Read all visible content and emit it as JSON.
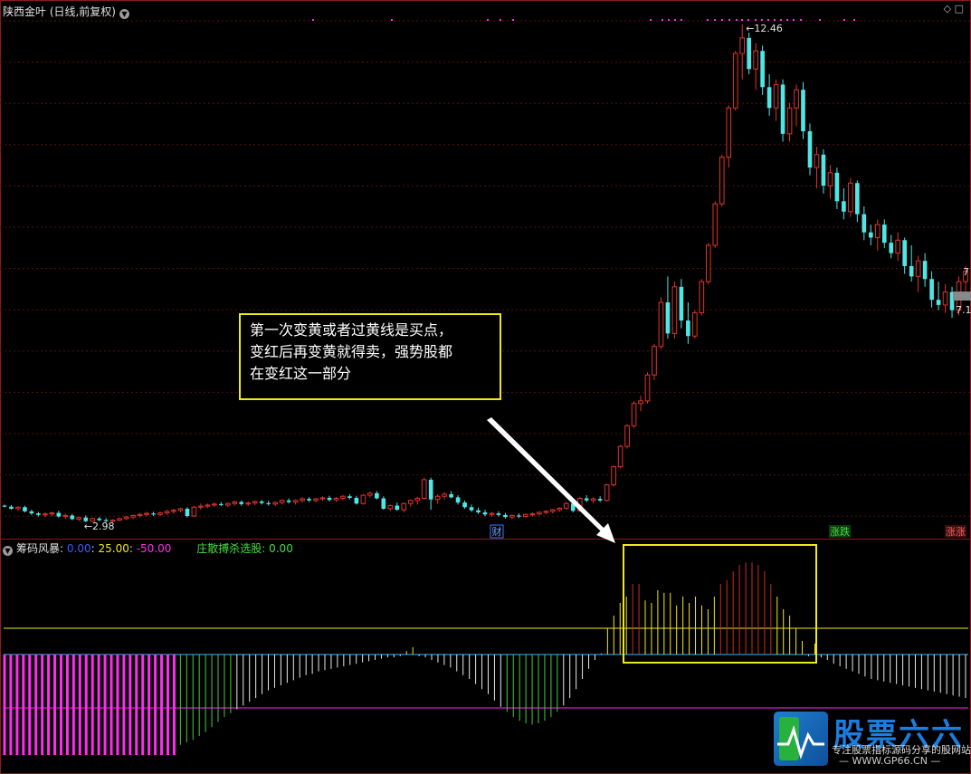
{
  "header": {
    "title": "陕西金叶 (日线,前复权)",
    "dropdown_icon": "chevron-down-icon",
    "right_icons": "◇ □"
  },
  "indicator_header": {
    "name": "筹码风暴",
    "v1": "0.00",
    "v2": "25.00",
    "v3": "-50.00",
    "sep": ":",
    "label2": "庄散搏杀选股:",
    "v4": "0.00"
  },
  "colors": {
    "up": "#e0342a",
    "down": "#50e6e6",
    "yellow": "#f0e81c",
    "magenta": "#ff2cf0",
    "green": "#44cc44",
    "grid": "#5a0e0e"
  },
  "markers": {
    "cai": "财",
    "fluctuate": "涨跌",
    "limit_up": "涨涨"
  },
  "price_labels": {
    "high": "12.46",
    "low": "2.98",
    "right_top": "7",
    "right_bottom": "7.1"
  },
  "annotation": {
    "line1": "第一次变黄或者过黄线是买点，",
    "line2": "变红后再变黄就得卖，强势股都",
    "line3": "在变红这一部分"
  },
  "logo": {
    "name": "股票六六",
    "slogan": "专注股票指标源码分享的股网站",
    "url": "— WWW.GP66.CN —"
  },
  "chart_data": {
    "type": "candlestick",
    "title": "陕西金叶 (日线,前复权)",
    "annotations": [
      "12.46",
      "2.98"
    ],
    "candles_ohlc": [
      [
        3.18,
        3.2,
        3.15,
        3.16
      ],
      [
        3.16,
        3.19,
        3.1,
        3.12
      ],
      [
        3.12,
        3.17,
        3.08,
        3.15
      ],
      [
        3.15,
        3.18,
        3.05,
        3.07
      ],
      [
        3.07,
        3.1,
        3.0,
        3.03
      ],
      [
        3.03,
        3.06,
        2.97,
        3.0
      ],
      [
        3.0,
        3.05,
        2.96,
        3.02
      ],
      [
        3.02,
        3.06,
        2.98,
        3.04
      ],
      [
        3.04,
        3.08,
        2.95,
        2.97
      ],
      [
        2.97,
        3.02,
        2.92,
        2.99
      ],
      [
        2.99,
        3.02,
        2.9,
        2.92
      ],
      [
        2.92,
        2.97,
        2.88,
        2.95
      ],
      [
        2.95,
        2.99,
        2.86,
        2.88
      ],
      [
        2.88,
        2.95,
        2.86,
        2.93
      ],
      [
        2.93,
        2.96,
        2.88,
        2.9
      ],
      [
        2.9,
        2.94,
        2.86,
        2.88
      ],
      [
        2.88,
        2.92,
        2.86,
        2.9
      ],
      [
        2.9,
        2.95,
        2.88,
        2.93
      ],
      [
        2.93,
        2.98,
        2.9,
        2.96
      ],
      [
        2.96,
        3.01,
        2.92,
        2.99
      ],
      [
        2.99,
        3.04,
        2.95,
        3.01
      ],
      [
        3.01,
        3.06,
        2.97,
        3.03
      ],
      [
        3.03,
        3.06,
        2.98,
        3.01
      ],
      [
        3.01,
        3.06,
        2.98,
        3.04
      ],
      [
        3.04,
        3.1,
        3.0,
        3.07
      ],
      [
        3.07,
        3.12,
        3.02,
        3.09
      ],
      [
        3.09,
        3.14,
        3.05,
        3.12
      ],
      [
        3.12,
        3.15,
        2.95,
        2.98
      ],
      [
        2.98,
        3.18,
        2.96,
        3.15
      ],
      [
        3.15,
        3.22,
        3.1,
        3.17
      ],
      [
        3.17,
        3.22,
        3.13,
        3.19
      ],
      [
        3.19,
        3.24,
        3.15,
        3.21
      ],
      [
        3.21,
        3.25,
        3.17,
        3.19
      ],
      [
        3.19,
        3.24,
        3.15,
        3.22
      ],
      [
        3.22,
        3.28,
        3.18,
        3.25
      ],
      [
        3.25,
        3.28,
        3.18,
        3.21
      ],
      [
        3.21,
        3.26,
        3.17,
        3.23
      ],
      [
        3.23,
        3.28,
        3.19,
        3.26
      ],
      [
        3.26,
        3.29,
        3.2,
        3.23
      ],
      [
        3.23,
        3.27,
        3.18,
        3.21
      ],
      [
        3.21,
        3.26,
        3.17,
        3.24
      ],
      [
        3.24,
        3.3,
        3.2,
        3.28
      ],
      [
        3.28,
        3.32,
        3.22,
        3.25
      ],
      [
        3.25,
        3.3,
        3.2,
        3.28
      ],
      [
        3.28,
        3.34,
        3.24,
        3.31
      ],
      [
        3.31,
        3.34,
        3.25,
        3.28
      ],
      [
        3.28,
        3.33,
        3.24,
        3.31
      ],
      [
        3.31,
        3.36,
        3.27,
        3.33
      ],
      [
        3.33,
        3.37,
        3.26,
        3.29
      ],
      [
        3.29,
        3.35,
        3.25,
        3.32
      ],
      [
        3.32,
        3.38,
        3.28,
        3.36
      ],
      [
        3.36,
        3.4,
        3.3,
        3.33
      ],
      [
        3.33,
        3.37,
        3.2,
        3.22
      ],
      [
        3.22,
        3.4,
        3.2,
        3.38
      ],
      [
        3.38,
        3.45,
        3.34,
        3.42
      ],
      [
        3.42,
        3.46,
        3.3,
        3.32
      ],
      [
        3.32,
        3.36,
        3.1,
        3.12
      ],
      [
        3.12,
        3.2,
        3.08,
        3.18
      ],
      [
        3.18,
        3.24,
        3.08,
        3.1
      ],
      [
        3.1,
        3.24,
        3.05,
        3.22
      ],
      [
        3.22,
        3.3,
        3.16,
        3.28
      ],
      [
        3.28,
        3.35,
        3.2,
        3.32
      ],
      [
        3.32,
        3.72,
        3.3,
        3.68
      ],
      [
        3.68,
        3.72,
        3.1,
        3.3
      ],
      [
        3.3,
        3.4,
        3.22,
        3.36
      ],
      [
        3.36,
        3.44,
        3.3,
        3.4
      ],
      [
        3.4,
        3.46,
        3.32,
        3.34
      ],
      [
        3.34,
        3.38,
        3.2,
        3.24
      ],
      [
        3.24,
        3.28,
        3.12,
        3.15
      ],
      [
        3.15,
        3.2,
        3.06,
        3.09
      ],
      [
        3.09,
        3.14,
        3.02,
        3.05
      ],
      [
        3.05,
        3.1,
        2.98,
        3.01
      ],
      [
        3.01,
        3.06,
        2.96,
        3.03
      ],
      [
        3.03,
        3.07,
        2.97,
        3.0
      ],
      [
        3.0,
        3.04,
        2.93,
        2.96
      ],
      [
        2.96,
        3.01,
        2.92,
        2.99
      ],
      [
        2.99,
        3.03,
        2.94,
        2.97
      ],
      [
        2.97,
        3.03,
        2.95,
        3.01
      ],
      [
        3.01,
        3.05,
        2.97,
        3.02
      ],
      [
        3.02,
        3.07,
        2.99,
        3.05
      ],
      [
        3.05,
        3.09,
        3.01,
        3.07
      ],
      [
        3.07,
        3.12,
        3.03,
        3.1
      ],
      [
        3.1,
        3.15,
        3.06,
        3.13
      ],
      [
        3.13,
        3.25,
        3.1,
        3.22
      ],
      [
        3.22,
        3.28,
        3.05,
        3.08
      ],
      [
        3.08,
        3.35,
        3.06,
        3.32
      ],
      [
        3.32,
        3.38,
        3.25,
        3.28
      ],
      [
        3.28,
        3.34,
        3.22,
        3.31
      ],
      [
        3.31,
        3.36,
        3.25,
        3.28
      ],
      [
        3.28,
        3.6,
        3.26,
        3.58
      ],
      [
        3.58,
        3.95,
        3.55,
        3.93
      ],
      [
        3.93,
        4.35,
        3.9,
        4.32
      ],
      [
        4.32,
        4.75,
        4.28,
        4.72
      ],
      [
        4.72,
        5.2,
        4.68,
        5.15
      ],
      [
        5.15,
        5.3,
        5.0,
        5.2
      ],
      [
        5.2,
        5.75,
        5.15,
        5.7
      ],
      [
        5.7,
        6.3,
        5.6,
        6.25
      ],
      [
        6.25,
        7.2,
        6.2,
        7.1
      ],
      [
        7.1,
        7.6,
        6.4,
        6.5
      ],
      [
        6.5,
        7.5,
        6.4,
        7.4
      ],
      [
        7.4,
        7.55,
        6.6,
        6.75
      ],
      [
        6.75,
        7.1,
        6.3,
        6.45
      ],
      [
        6.45,
        6.95,
        6.4,
        6.9
      ],
      [
        6.9,
        7.55,
        6.85,
        7.5
      ],
      [
        7.5,
        8.25,
        7.45,
        8.2
      ],
      [
        8.2,
        9.05,
        8.15,
        9.0
      ],
      [
        9.0,
        9.95,
        8.95,
        9.9
      ],
      [
        9.9,
        10.9,
        9.7,
        10.85
      ],
      [
        10.85,
        11.95,
        10.8,
        11.9
      ],
      [
        11.9,
        12.46,
        11.4,
        12.2
      ],
      [
        12.2,
        12.3,
        11.5,
        11.6
      ],
      [
        11.6,
        12.1,
        11.2,
        11.95
      ],
      [
        11.95,
        12.05,
        11.1,
        11.25
      ],
      [
        11.25,
        11.5,
        10.7,
        10.85
      ],
      [
        10.85,
        11.4,
        10.6,
        11.3
      ],
      [
        11.3,
        11.4,
        10.2,
        10.35
      ],
      [
        10.35,
        10.95,
        10.2,
        10.85
      ],
      [
        10.85,
        11.3,
        10.5,
        11.2
      ],
      [
        11.2,
        11.35,
        10.25,
        10.4
      ],
      [
        10.4,
        10.55,
        9.55,
        9.7
      ],
      [
        9.7,
        10.1,
        9.3,
        9.95
      ],
      [
        9.95,
        10.05,
        9.2,
        9.35
      ],
      [
        9.35,
        9.75,
        9.1,
        9.6
      ],
      [
        9.6,
        9.7,
        8.9,
        9.05
      ],
      [
        9.05,
        9.3,
        8.7,
        8.85
      ],
      [
        8.85,
        9.5,
        8.75,
        9.4
      ],
      [
        9.4,
        9.45,
        8.65,
        8.8
      ],
      [
        8.8,
        8.95,
        8.3,
        8.45
      ],
      [
        8.45,
        8.6,
        8.2,
        8.35
      ],
      [
        8.35,
        8.7,
        8.1,
        8.6
      ],
      [
        8.6,
        8.7,
        8.15,
        8.25
      ],
      [
        8.25,
        8.4,
        7.95,
        8.05
      ],
      [
        8.05,
        8.45,
        7.9,
        8.3
      ],
      [
        8.3,
        8.35,
        7.65,
        7.8
      ],
      [
        7.8,
        8.2,
        7.5,
        7.6
      ],
      [
        7.6,
        8.0,
        7.3,
        7.9
      ],
      [
        7.9,
        8.05,
        7.4,
        7.55
      ],
      [
        7.55,
        7.7,
        7.0,
        7.15
      ],
      [
        7.15,
        7.5,
        6.95,
        7.05
      ],
      [
        7.05,
        7.45,
        6.9,
        7.3
      ],
      [
        7.3,
        7.4,
        6.8,
        6.95
      ],
      [
        6.95,
        7.6,
        6.85,
        7.5
      ],
      [
        7.5,
        7.8,
        7.3,
        7.7
      ]
    ],
    "indicator_levels": {
      "v1": 0.0,
      "v2": 25.0,
      "v3": -50.0
    },
    "indicator": [
      -80,
      -80,
      -80,
      -80,
      -80,
      -80,
      -80,
      -80,
      -80,
      -80,
      -80,
      -80,
      -80,
      -80,
      -80,
      -80,
      -80,
      -80,
      -80,
      -80,
      -80,
      -80,
      -80,
      -80,
      -80,
      -80,
      -80,
      -80,
      -72,
      -70,
      -68,
      -65,
      -62,
      -58,
      -54,
      -50,
      -47,
      -44,
      -41,
      -38,
      -35,
      -32,
      -29,
      -27,
      -25,
      -23,
      -21,
      -19,
      -17,
      -16,
      -14,
      -13,
      -12,
      -11,
      -10,
      -9,
      -8,
      -7,
      -6,
      -5,
      -4,
      -3,
      -3,
      -2,
      2,
      5,
      -2,
      -3,
      -5,
      -7,
      -9,
      -11,
      -14,
      -17,
      -20,
      -24,
      -28,
      -32,
      -37,
      -42,
      -46,
      -50,
      -53,
      -55,
      -56,
      -55,
      -53,
      -50,
      -46,
      -41,
      -35,
      -28,
      -20,
      -12,
      -5,
      0,
      20,
      30,
      40,
      45,
      55,
      55,
      42,
      40,
      50,
      48,
      48,
      38,
      45,
      40,
      45,
      38,
      35,
      45,
      55,
      58,
      65,
      70,
      72,
      72,
      70,
      65,
      55,
      45,
      35,
      30,
      20,
      10,
      -2,
      8,
      -3,
      -5,
      -8,
      -10,
      -12,
      -14,
      -16,
      -18,
      -20,
      -21,
      -22,
      -23,
      -24,
      -25,
      -26,
      -27,
      -28,
      -29,
      -30,
      -31,
      -32,
      -33,
      -34,
      -35
    ]
  }
}
